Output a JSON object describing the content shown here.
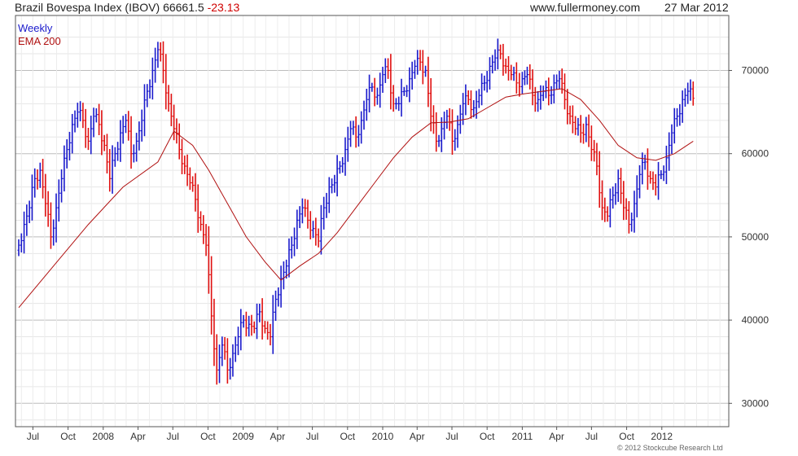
{
  "header": {
    "title": "Brazil Bovespa Index (IBOV) 66661.5",
    "change": "-23.13",
    "site": "www.fullermoney.com",
    "date": "27 Mar 2012"
  },
  "legend": {
    "series1": "Weekly",
    "series2": "EMA 200"
  },
  "footer": {
    "copyright": "© 2012 Stockcube Research Ltd"
  },
  "chart_data": {
    "type": "line",
    "title": "Brazil Bovespa Index (IBOV) 66661.5 -23.13",
    "xlabel": "",
    "ylabel": "",
    "x_range": [
      "2007-05",
      "2012-03"
    ],
    "ylim": [
      27000,
      75000
    ],
    "y_ticks": [
      30000,
      40000,
      50000,
      60000,
      70000
    ],
    "y_tick_labels": [
      "30000",
      "40000",
      "50000",
      "60000",
      "70000"
    ],
    "x_ticks": [
      {
        "label": "Jul",
        "date": "2007-07"
      },
      {
        "label": "Oct",
        "date": "2007-10"
      },
      {
        "label": "2008",
        "date": "2008-01"
      },
      {
        "label": "Apr",
        "date": "2008-04"
      },
      {
        "label": "Jul",
        "date": "2008-07"
      },
      {
        "label": "Oct",
        "date": "2008-10"
      },
      {
        "label": "2009",
        "date": "2009-01"
      },
      {
        "label": "Apr",
        "date": "2009-04"
      },
      {
        "label": "Jul",
        "date": "2009-07"
      },
      {
        "label": "Oct",
        "date": "2009-10"
      },
      {
        "label": "2010",
        "date": "2010-01"
      },
      {
        "label": "Apr",
        "date": "2010-04"
      },
      {
        "label": "Jul",
        "date": "2010-07"
      },
      {
        "label": "Oct",
        "date": "2010-10"
      },
      {
        "label": "2011",
        "date": "2011-01"
      },
      {
        "label": "Apr",
        "date": "2011-04"
      },
      {
        "label": "Jul",
        "date": "2011-07"
      },
      {
        "label": "Oct",
        "date": "2011-10"
      },
      {
        "label": "2012",
        "date": "2012-01"
      }
    ],
    "grid": true,
    "legend_position": "top-left",
    "series": [
      {
        "name": "Weekly",
        "style": "up/down weekly bars",
        "up_color": "#1a1acc",
        "down_color": "#e01010",
        "points": [
          [
            "2007-05-25",
            49000
          ],
          [
            "2007-06-08",
            51500
          ],
          [
            "2007-06-22",
            53500
          ],
          [
            "2007-07-06",
            57000
          ],
          [
            "2007-07-20",
            58000
          ],
          [
            "2007-08-03",
            54000
          ],
          [
            "2007-08-17",
            50000
          ],
          [
            "2007-08-31",
            53500
          ],
          [
            "2007-09-14",
            57000
          ],
          [
            "2007-09-28",
            60500
          ],
          [
            "2007-10-12",
            63500
          ],
          [
            "2007-10-26",
            65000
          ],
          [
            "2007-11-09",
            64000
          ],
          [
            "2007-11-23",
            61500
          ],
          [
            "2007-12-07",
            64500
          ],
          [
            "2007-12-21",
            63500
          ],
          [
            "2008-01-04",
            61000
          ],
          [
            "2008-01-18",
            57000
          ],
          [
            "2008-02-01",
            60000
          ],
          [
            "2008-02-15",
            62500
          ],
          [
            "2008-02-29",
            64000
          ],
          [
            "2008-03-14",
            60000
          ],
          [
            "2008-03-28",
            61500
          ],
          [
            "2008-04-11",
            64000
          ],
          [
            "2008-04-25",
            67500
          ],
          [
            "2008-05-09",
            70000
          ],
          [
            "2008-05-23",
            72500
          ],
          [
            "2008-06-06",
            70000
          ],
          [
            "2008-06-20",
            66000
          ],
          [
            "2008-07-04",
            63000
          ],
          [
            "2008-07-18",
            60500
          ],
          [
            "2008-08-01",
            58500
          ],
          [
            "2008-08-15",
            56500
          ],
          [
            "2008-08-29",
            54500
          ],
          [
            "2008-09-12",
            51500
          ],
          [
            "2008-09-26",
            49000
          ],
          [
            "2008-10-10",
            40500
          ],
          [
            "2008-10-24",
            34000
          ],
          [
            "2008-11-07",
            37000
          ],
          [
            "2008-11-21",
            34000
          ],
          [
            "2008-12-05",
            36000
          ],
          [
            "2008-12-19",
            38000
          ],
          [
            "2009-01-02",
            40000
          ],
          [
            "2009-01-16",
            39500
          ],
          [
            "2009-01-30",
            39000
          ],
          [
            "2009-02-13",
            41000
          ],
          [
            "2009-02-27",
            39000
          ],
          [
            "2009-03-13",
            38000
          ],
          [
            "2009-03-27",
            42500
          ],
          [
            "2009-04-10",
            45000
          ],
          [
            "2009-04-24",
            46500
          ],
          [
            "2009-05-08",
            49000
          ],
          [
            "2009-05-22",
            52000
          ],
          [
            "2009-06-05",
            53500
          ],
          [
            "2009-06-19",
            52000
          ],
          [
            "2009-07-03",
            51000
          ],
          [
            "2009-07-17",
            49500
          ],
          [
            "2009-07-31",
            53500
          ],
          [
            "2009-08-14",
            56000
          ],
          [
            "2009-08-28",
            56500
          ],
          [
            "2009-09-11",
            58500
          ],
          [
            "2009-09-25",
            60500
          ],
          [
            "2009-10-09",
            63000
          ],
          [
            "2009-10-23",
            62000
          ],
          [
            "2009-11-06",
            64000
          ],
          [
            "2009-11-20",
            66500
          ],
          [
            "2009-12-04",
            68000
          ],
          [
            "2009-12-18",
            67000
          ],
          [
            "2010-01-01",
            69500
          ],
          [
            "2010-01-15",
            70000
          ],
          [
            "2010-01-29",
            66000
          ],
          [
            "2010-02-12",
            66000
          ],
          [
            "2010-02-26",
            67500
          ],
          [
            "2010-03-12",
            69000
          ],
          [
            "2010-03-26",
            70500
          ],
          [
            "2010-04-09",
            71000
          ],
          [
            "2010-04-23",
            70000
          ],
          [
            "2010-05-07",
            64500
          ],
          [
            "2010-05-21",
            61500
          ],
          [
            "2010-06-04",
            63000
          ],
          [
            "2010-06-18",
            64500
          ],
          [
            "2010-07-02",
            61500
          ],
          [
            "2010-07-16",
            63500
          ],
          [
            "2010-07-30",
            66000
          ],
          [
            "2010-08-13",
            66500
          ],
          [
            "2010-08-27",
            65500
          ],
          [
            "2010-09-10",
            67000
          ],
          [
            "2010-09-24",
            68500
          ],
          [
            "2010-10-08",
            70500
          ],
          [
            "2010-10-22",
            71500
          ],
          [
            "2010-11-05",
            72000
          ],
          [
            "2010-11-19",
            70500
          ],
          [
            "2010-12-03",
            69500
          ],
          [
            "2010-12-17",
            68500
          ],
          [
            "2011-01-01",
            69000
          ],
          [
            "2011-01-14",
            69500
          ],
          [
            "2011-01-28",
            67000
          ],
          [
            "2011-02-11",
            66500
          ],
          [
            "2011-02-25",
            67500
          ],
          [
            "2011-03-11",
            67000
          ],
          [
            "2011-03-25",
            68500
          ],
          [
            "2011-04-08",
            69000
          ],
          [
            "2011-04-22",
            66500
          ],
          [
            "2011-05-06",
            64500
          ],
          [
            "2011-05-20",
            63000
          ],
          [
            "2011-06-03",
            62500
          ],
          [
            "2011-06-17",
            63500
          ],
          [
            "2011-07-01",
            60500
          ],
          [
            "2011-07-15",
            58500
          ],
          [
            "2011-07-29",
            53500
          ],
          [
            "2011-08-12",
            52500
          ],
          [
            "2011-08-26",
            55000
          ],
          [
            "2011-09-09",
            57000
          ],
          [
            "2011-09-23",
            53500
          ],
          [
            "2011-10-07",
            51500
          ],
          [
            "2011-10-21",
            54000
          ],
          [
            "2011-11-04",
            57500
          ],
          [
            "2011-11-18",
            59000
          ],
          [
            "2011-12-02",
            57000
          ],
          [
            "2011-12-16",
            56000
          ],
          [
            "2011-12-30",
            57500
          ],
          [
            "2012-01-13",
            59500
          ],
          [
            "2012-01-27",
            62500
          ],
          [
            "2012-02-10",
            64500
          ],
          [
            "2012-02-24",
            66500
          ],
          [
            "2012-03-09",
            67500
          ],
          [
            "2012-03-23",
            66661.5
          ]
        ]
      },
      {
        "name": "EMA 200",
        "color": "#b01010",
        "points": [
          [
            "2007-05-25",
            41500
          ],
          [
            "2007-08-24",
            46500
          ],
          [
            "2007-11-23",
            51500
          ],
          [
            "2008-02-22",
            56000
          ],
          [
            "2008-05-23",
            59000
          ],
          [
            "2008-07-04",
            62700
          ],
          [
            "2008-08-22",
            61000
          ],
          [
            "2008-10-03",
            58000
          ],
          [
            "2008-11-21",
            54000
          ],
          [
            "2009-01-09",
            50000
          ],
          [
            "2009-02-27",
            47000
          ],
          [
            "2009-04-10",
            44800
          ],
          [
            "2009-05-29",
            46500
          ],
          [
            "2009-07-17",
            48000
          ],
          [
            "2009-09-04",
            50500
          ],
          [
            "2009-10-23",
            53500
          ],
          [
            "2009-12-11",
            56500
          ],
          [
            "2010-01-29",
            59500
          ],
          [
            "2010-03-19",
            62000
          ],
          [
            "2010-05-07",
            63700
          ],
          [
            "2010-06-25",
            63800
          ],
          [
            "2010-08-13",
            64200
          ],
          [
            "2010-10-01",
            65500
          ],
          [
            "2010-11-19",
            66800
          ],
          [
            "2011-01-07",
            67200
          ],
          [
            "2011-02-25",
            67500
          ],
          [
            "2011-04-15",
            67800
          ],
          [
            "2011-06-03",
            66500
          ],
          [
            "2011-07-22",
            64000
          ],
          [
            "2011-09-09",
            61000
          ],
          [
            "2011-10-28",
            59500
          ],
          [
            "2011-12-16",
            59200
          ],
          [
            "2012-02-03",
            60000
          ],
          [
            "2012-03-23",
            61500
          ]
        ]
      }
    ],
    "annotations": []
  }
}
